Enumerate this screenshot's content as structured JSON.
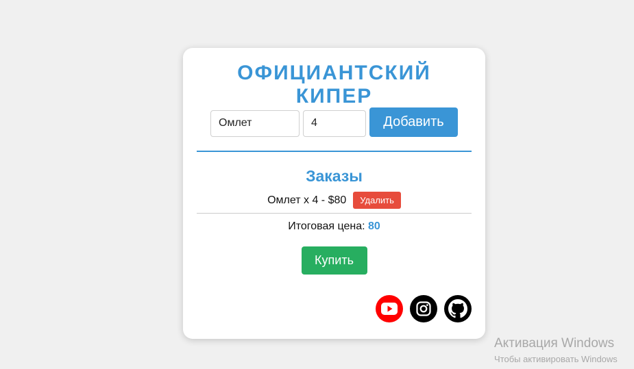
{
  "app": {
    "title": "ОФИЦИАНТСКИЙ КИПЕР"
  },
  "form": {
    "dish_value": "Омлет",
    "qty_value": "4",
    "add_label": "Добавить"
  },
  "orders": {
    "heading": "Заказы",
    "items": [
      {
        "text": "Омлет x 4 - $80",
        "delete_label": "Удалить"
      }
    ],
    "total_label": "Итоговая цена: ",
    "total_value": "80"
  },
  "buy_label": "Купить",
  "social": [
    "youtube-icon",
    "instagram-icon",
    "github-icon"
  ],
  "colors": {
    "accent": "#3a95d6",
    "delete": "#e74c3c",
    "buy": "#27ae60",
    "youtube": "#ff0000"
  },
  "watermark": {
    "title": "Активация Windows",
    "subtitle": "Чтобы активировать Windows"
  }
}
